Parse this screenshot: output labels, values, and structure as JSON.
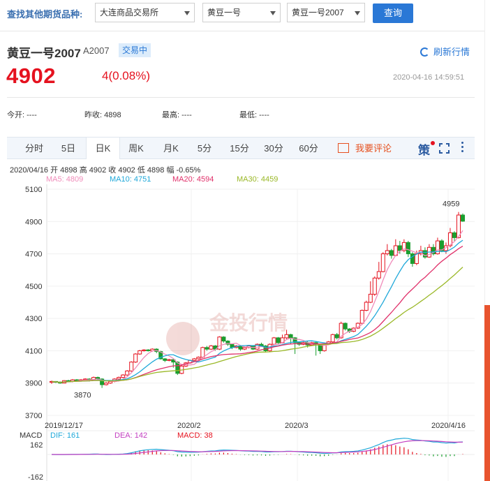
{
  "search": {
    "label": "查找其他期货品种:",
    "exchange": "大连商品交易所",
    "variety": "黄豆一号",
    "contract": "黄豆一号2007",
    "query_button": "查询"
  },
  "quote": {
    "name": "黄豆一号2007",
    "code": "A2007",
    "status": "交易中",
    "refresh": "刷新行情",
    "price": "4902",
    "change": "4(0.08%)",
    "time": "2020-04-16 14:59:51"
  },
  "stats": {
    "open_label": "今开:",
    "open": "----",
    "prev_label": "昨收:",
    "prev": "4898",
    "high_label": "最高:",
    "high": "----",
    "low_label": "最低:",
    "low": "----"
  },
  "tabs": [
    "分时",
    "5日",
    "日K",
    "周K",
    "月K",
    "5分",
    "15分",
    "30分",
    "60分"
  ],
  "active_tab": "日K",
  "toolbar": {
    "comment": "我要评论",
    "ce": "策"
  },
  "ohlc_line": "2020/04/16  开 4898  高 4902  收 4902  低 4898  幅 -0.65%",
  "ma_legend": [
    {
      "text": "MA5: 4809",
      "color": "#f08cba"
    },
    {
      "text": "MA10: 4751",
      "color": "#1fa8d9"
    },
    {
      "text": "MA20: 4594",
      "color": "#e0306a"
    },
    {
      "text": "MA30: 4459",
      "color": "#9ab827"
    }
  ],
  "watermark": "金投行情",
  "macd_legend": {
    "label": "MACD",
    "dif": "DIF: 161",
    "dea": "DEA: 142",
    "macd": "MACD: 38"
  },
  "colors": {
    "up": "#e5121f",
    "down": "#1a9e2f",
    "accent": "#2a78d6"
  },
  "chart_data": {
    "type": "candlestick",
    "y_ticks": [
      "5100",
      "4900",
      "4700",
      "4500",
      "4300",
      "4100",
      "3900",
      "3700"
    ],
    "ylim": [
      3700,
      5100
    ],
    "x_labels": [
      "2019/12/17",
      "2020/2",
      "2020/3",
      "2020/4/16"
    ],
    "annotations": {
      "max": "4959",
      "min": "3870"
    },
    "macd_ticks": [
      "162",
      "-162"
    ],
    "candles": [
      [
        3905,
        3910,
        3895,
        3915
      ],
      [
        3910,
        3905,
        3900,
        3912
      ],
      [
        3905,
        3900,
        3895,
        3910
      ],
      [
        3900,
        3915,
        3898,
        3918
      ],
      [
        3915,
        3910,
        3905,
        3920
      ],
      [
        3910,
        3920,
        3905,
        3925
      ],
      [
        3920,
        3915,
        3910,
        3925
      ],
      [
        3915,
        3920,
        3910,
        3925
      ],
      [
        3920,
        3925,
        3915,
        3930
      ],
      [
        3925,
        3920,
        3910,
        3930
      ],
      [
        3920,
        3935,
        3915,
        3940
      ],
      [
        3935,
        3925,
        3920,
        3940
      ],
      [
        3925,
        3890,
        3870,
        3930
      ],
      [
        3890,
        3900,
        3885,
        3905
      ],
      [
        3900,
        3910,
        3895,
        3915
      ],
      [
        3910,
        3925,
        3905,
        3930
      ],
      [
        3925,
        3935,
        3920,
        3940
      ],
      [
        3935,
        3950,
        3930,
        3955
      ],
      [
        3950,
        3975,
        3945,
        3980
      ],
      [
        3975,
        4030,
        3970,
        4035
      ],
      [
        4030,
        4080,
        4025,
        4085
      ],
      [
        4080,
        4100,
        4075,
        4105
      ],
      [
        4100,
        4105,
        4095,
        4110
      ],
      [
        4105,
        4100,
        4095,
        4110
      ],
      [
        4100,
        4110,
        4095,
        4115
      ],
      [
        4110,
        4095,
        4085,
        4115
      ],
      [
        4095,
        4050,
        4045,
        4100
      ],
      [
        4050,
        4040,
        4030,
        4055
      ],
      [
        4040,
        4045,
        4035,
        4050
      ],
      [
        4045,
        4030,
        3995,
        4050
      ],
      [
        4030,
        3960,
        3950,
        4035
      ],
      [
        3960,
        4005,
        3955,
        4010
      ],
      [
        4005,
        4025,
        4000,
        4030
      ],
      [
        4025,
        4040,
        4020,
        4045
      ],
      [
        4040,
        4050,
        4035,
        4055
      ],
      [
        4050,
        4060,
        4045,
        4065
      ],
      [
        4060,
        4120,
        4055,
        4125
      ],
      [
        4120,
        4110,
        4100,
        4130
      ],
      [
        4110,
        4130,
        4105,
        4135
      ],
      [
        4130,
        4110,
        4100,
        4135
      ],
      [
        4110,
        4185,
        4105,
        4190
      ],
      [
        4185,
        4160,
        4150,
        4190
      ],
      [
        4160,
        4140,
        4130,
        4165
      ],
      [
        4140,
        4120,
        4110,
        4145
      ],
      [
        4120,
        4130,
        4115,
        4135
      ],
      [
        4130,
        4110,
        4100,
        4135
      ],
      [
        4110,
        4120,
        4105,
        4125
      ],
      [
        4120,
        4130,
        4115,
        4135
      ],
      [
        4130,
        4110,
        4105,
        4135
      ],
      [
        4110,
        4140,
        4105,
        4145
      ],
      [
        4140,
        4130,
        4125,
        4150
      ],
      [
        4130,
        4100,
        4090,
        4135
      ],
      [
        4100,
        4140,
        4095,
        4145
      ],
      [
        4140,
        4180,
        4135,
        4185
      ],
      [
        4180,
        4150,
        4140,
        4185
      ],
      [
        4150,
        4180,
        4145,
        4200
      ],
      [
        4180,
        4200,
        4170,
        4230
      ],
      [
        4200,
        4180,
        4140,
        4205
      ],
      [
        4180,
        4150,
        4080,
        4185
      ],
      [
        4150,
        4140,
        4130,
        4155
      ],
      [
        4140,
        4150,
        4135,
        4160
      ],
      [
        4150,
        4135,
        4120,
        4160
      ],
      [
        4135,
        4150,
        4130,
        4155
      ],
      [
        4150,
        4140,
        4070,
        4160
      ],
      [
        4140,
        4100,
        4080,
        4145
      ],
      [
        4100,
        4140,
        4095,
        4145
      ],
      [
        4140,
        4155,
        4135,
        4160
      ],
      [
        4155,
        4200,
        4150,
        4205
      ],
      [
        4200,
        4180,
        4170,
        4210
      ],
      [
        4180,
        4270,
        4175,
        4280
      ],
      [
        4270,
        4235,
        4225,
        4275
      ],
      [
        4235,
        4220,
        4210,
        4240
      ],
      [
        4220,
        4240,
        4215,
        4245
      ],
      [
        4240,
        4270,
        4235,
        4275
      ],
      [
        4270,
        4350,
        4265,
        4355
      ],
      [
        4350,
        4400,
        4345,
        4410
      ],
      [
        4400,
        4450,
        4395,
        4530
      ],
      [
        4450,
        4550,
        4440,
        4560
      ],
      [
        4550,
        4590,
        4540,
        4650
      ],
      [
        4590,
        4700,
        4585,
        4710
      ],
      [
        4700,
        4720,
        4690,
        4760
      ],
      [
        4720,
        4690,
        4670,
        4730
      ],
      [
        4690,
        4750,
        4685,
        4790
      ],
      [
        4750,
        4720,
        4700,
        4780
      ],
      [
        4720,
        4770,
        4710,
        4790
      ],
      [
        4770,
        4700,
        4680,
        4780
      ],
      [
        4700,
        4640,
        4620,
        4710
      ],
      [
        4640,
        4700,
        4630,
        4720
      ],
      [
        4700,
        4720,
        4690,
        4750
      ],
      [
        4720,
        4680,
        4670,
        4740
      ],
      [
        4680,
        4740,
        4675,
        4760
      ],
      [
        4740,
        4700,
        4690,
        4760
      ],
      [
        4700,
        4780,
        4695,
        4800
      ],
      [
        4780,
        4720,
        4710,
        4790
      ],
      [
        4720,
        4750,
        4700,
        4770
      ],
      [
        4750,
        4830,
        4740,
        4860
      ],
      [
        4830,
        4800,
        4780,
        4840
      ],
      [
        4800,
        4940,
        4795,
        4959
      ],
      [
        4940,
        4902,
        4898,
        4950
      ]
    ]
  }
}
